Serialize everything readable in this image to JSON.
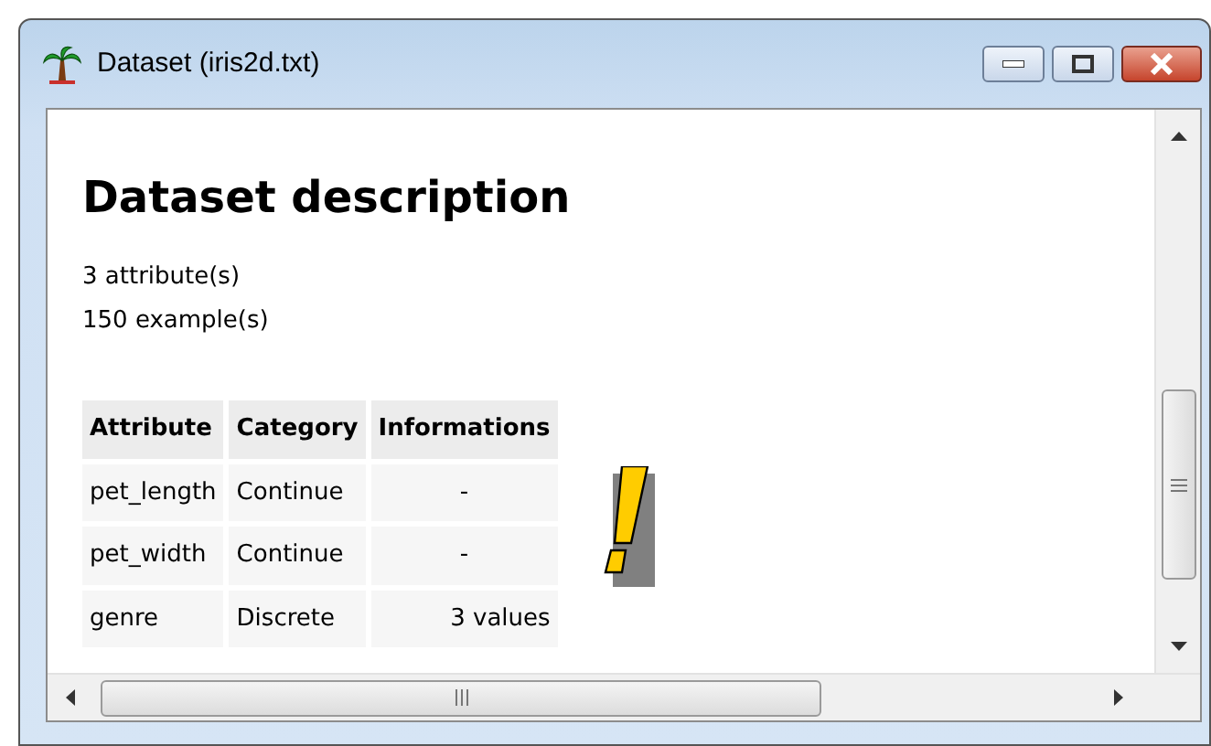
{
  "window": {
    "title": "Dataset (iris2d.txt)"
  },
  "heading": "Dataset description",
  "summary": [
    "3 attribute(s)",
    "150 example(s)"
  ],
  "table": {
    "columns": [
      "Attribute",
      "Category",
      "Informations"
    ],
    "rows": [
      [
        "pet_length",
        "Continue",
        "-"
      ],
      [
        "pet_width",
        "Continue",
        "-"
      ],
      [
        "genre",
        "Discrete",
        "3 values"
      ]
    ]
  }
}
